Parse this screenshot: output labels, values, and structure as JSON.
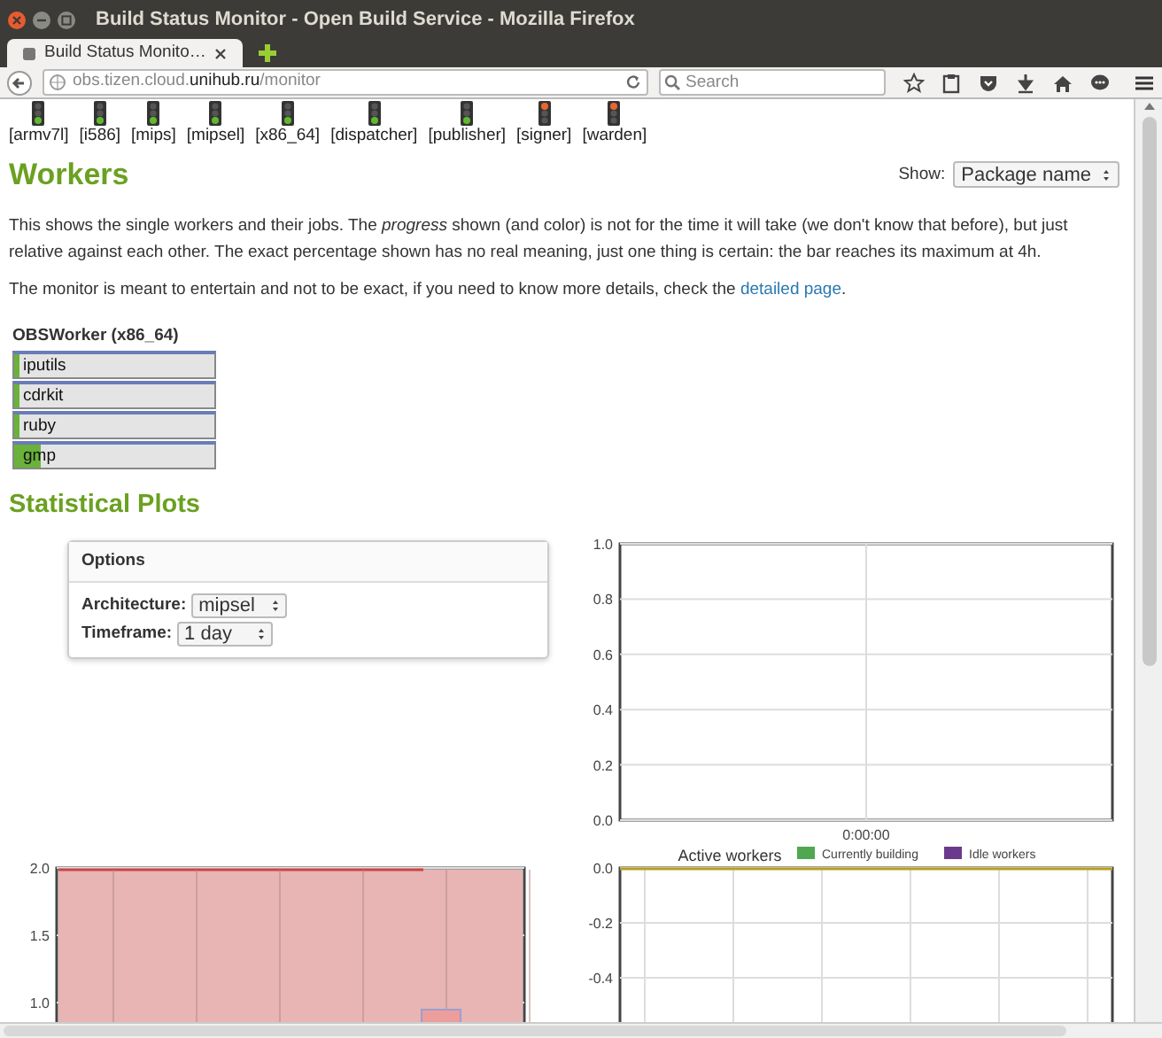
{
  "window": {
    "title": "Build Status Monitor - Open Build Service - Mozilla Firefox"
  },
  "tabs": [
    {
      "label": "Build Status Monito…",
      "selected": true
    }
  ],
  "address_bar": {
    "url": "obs.tizen.cloud.**unihub.ru**/monitor"
  },
  "search": {
    "placeholder": "Search"
  },
  "status_lights": [
    {
      "label": "[armv7l]",
      "stopped": false,
      "color": "#5fb82e"
    },
    {
      "label": "[i586]",
      "stopped": false,
      "color": "#5fb82e"
    },
    {
      "label": "[mips]",
      "stopped": false,
      "color": "#5fb82e"
    },
    {
      "label": "[mipsel]",
      "stopped": false,
      "color": "#5fb82e"
    },
    {
      "label": "[x86_64]",
      "stopped": false,
      "color": "#5fb82e"
    },
    {
      "label": "[dispatcher]",
      "stopped": false,
      "color": "#5fb82e"
    },
    {
      "label": "[publisher]",
      "stopped": false,
      "color": "#5fb82e"
    },
    {
      "label": "[signer]",
      "stopped": true,
      "color": "#e8672c"
    },
    {
      "label": "[warden]",
      "stopped": true,
      "color": "#e8672c"
    }
  ],
  "workers": {
    "heading": "Workers",
    "show_label": "Show:",
    "show_value": "Package name",
    "intro": "This shows the single workers and their jobs. The *progress* shown (and color) is not for the time it will take (we don't know that before), but just relative against each other. The exact percentage shown has no real meaning, just one thing is certain: the bar reaches its maximum at 4h.",
    "note": "The monitor is meant to entertain and not to be exact, if you need to know more details, check the",
    "note_link": "detailed page",
    "note_end": ".",
    "worker": {
      "name": "OBSWorker (x86_64)",
      "jobs": [
        {
          "name": "iputils",
          "level": 0.03
        },
        {
          "name": "cdrkit",
          "level": 0.03
        },
        {
          "name": "ruby",
          "level": 0.03
        },
        {
          "name": "gmp",
          "level": 0.13
        }
      ]
    }
  },
  "plots": {
    "heading": "Statistical Plots",
    "options": {
      "title": "Options",
      "fields": [
        {
          "label": "Architecture:",
          "value": "mipsel"
        },
        {
          "label": "Timeframe:",
          "value": "1 day"
        }
      ]
    },
    "top_plot": {
      "y_labels": [
        "1.0",
        "0.8",
        "0.6",
        "0.4",
        "0.2",
        "0.0"
      ],
      "x_label": "0:00:00"
    },
    "left_plot": {
      "y_labels": [
        "2.0",
        "1.5",
        "1.0"
      ]
    },
    "right_plot": {
      "title": "Active workers",
      "legend": [
        {
          "label": "Currently building",
          "color": "#4fa84f"
        },
        {
          "label": "Idle workers",
          "color": "#6c3a8c"
        }
      ],
      "y_labels": [
        "0.0",
        "-0.2",
        "-0.4"
      ]
    }
  }
}
